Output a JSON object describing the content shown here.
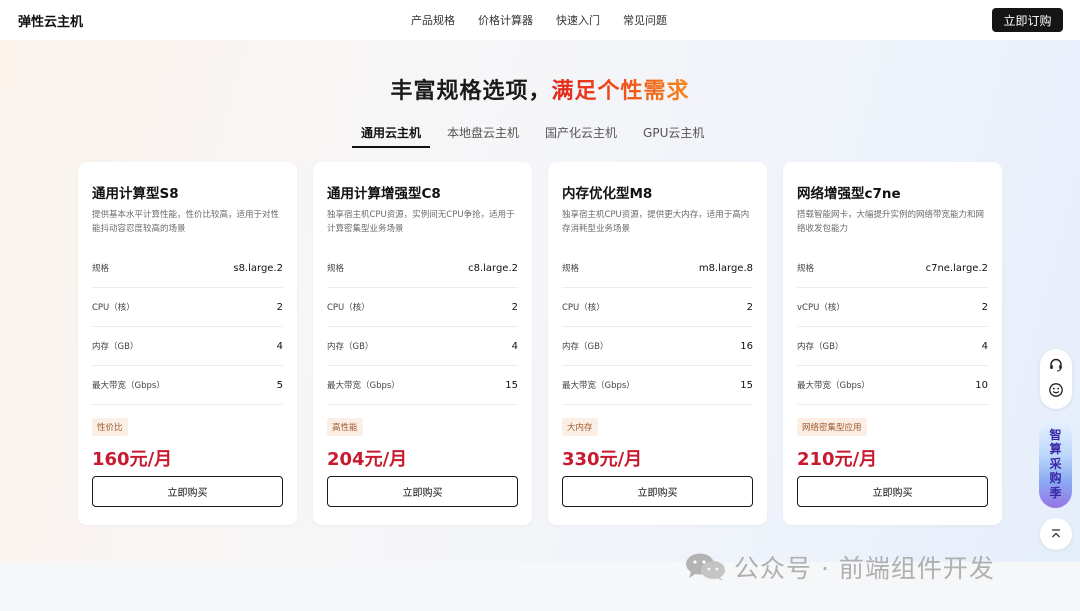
{
  "header": {
    "brand": "弹性云主机",
    "nav": [
      "产品规格",
      "价格计算器",
      "快速入门",
      "常见问题"
    ],
    "order_button": "立即订购"
  },
  "hero": {
    "headline_dark": "丰富规格选项，",
    "headline_accent": "满足个性需求"
  },
  "tabs": [
    {
      "label": "通用云主机",
      "active": true
    },
    {
      "label": "本地盘云主机",
      "active": false
    },
    {
      "label": "国产化云主机",
      "active": false
    },
    {
      "label": "GPU云主机",
      "active": false
    }
  ],
  "cards": [
    {
      "title": "通用计算型S8",
      "desc": "提供基本水平计算性能，性价比较高，适用于对性能抖动容忍度较高的场景",
      "specs": [
        {
          "key": "规格",
          "value": "s8.large.2"
        },
        {
          "key": "CPU（核）",
          "value": "2"
        },
        {
          "key": "内存（GB）",
          "value": "4"
        },
        {
          "key": "最大带宽（Gbps）",
          "value": "5"
        }
      ],
      "badge": "性价比",
      "price": "160元/月",
      "buy": "立即购买"
    },
    {
      "title": "通用计算增强型C8",
      "desc": "独享宿主机CPU资源，实例间无CPU争抢，适用于计算密集型业务场景",
      "specs": [
        {
          "key": "规格",
          "value": "c8.large.2"
        },
        {
          "key": "CPU（核）",
          "value": "2"
        },
        {
          "key": "内存（GB）",
          "value": "4"
        },
        {
          "key": "最大带宽（Gbps）",
          "value": "15"
        }
      ],
      "badge": "高性能",
      "price": "204元/月",
      "buy": "立即购买"
    },
    {
      "title": "内存优化型M8",
      "desc": "独享宿主机CPU资源，提供更大内存，适用于高内存消耗型业务场景",
      "specs": [
        {
          "key": "规格",
          "value": "m8.large.8"
        },
        {
          "key": "CPU（核）",
          "value": "2"
        },
        {
          "key": "内存（GB）",
          "value": "16"
        },
        {
          "key": "最大带宽（Gbps）",
          "value": "15"
        }
      ],
      "badge": "大内存",
      "price": "330元/月",
      "buy": "立即购买"
    },
    {
      "title": "网络增强型c7ne",
      "desc": "搭载智能网卡，大幅提升实例的网络带宽能力和网络收发包能力",
      "specs": [
        {
          "key": "规格",
          "value": "c7ne.large.2"
        },
        {
          "key": "vCPU（核）",
          "value": "2"
        },
        {
          "key": "内存（GB）",
          "value": "4"
        },
        {
          "key": "最大带宽（Gbps）",
          "value": "10"
        }
      ],
      "badge": "网络密集型应用",
      "price": "210元/月",
      "buy": "立即购买"
    }
  ],
  "sidebar": {
    "promo_chars": [
      "智",
      "算",
      "采",
      "购",
      "季"
    ],
    "icons": [
      "headset-icon",
      "smile-icon",
      "back-to-top-icon"
    ]
  },
  "watermark": {
    "text": "公众号 · 前端组件开发",
    "icon": "wechat-icon"
  },
  "colors": {
    "price": "#c71a2f",
    "accent_start": "#e0261b",
    "accent_end": "#f3891c",
    "dark_button": "#151515"
  }
}
